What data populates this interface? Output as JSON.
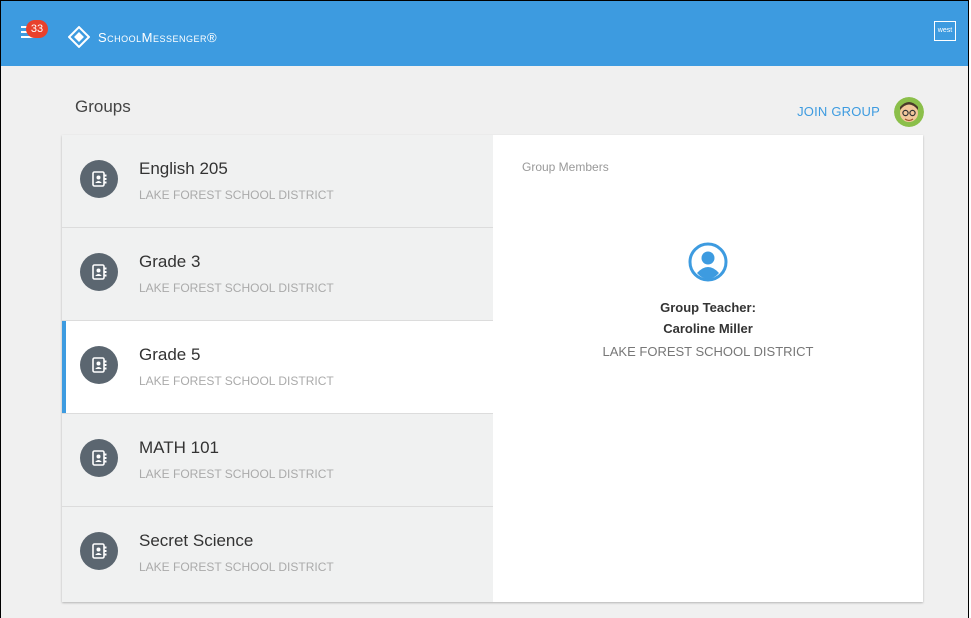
{
  "header": {
    "notification_count": "33",
    "brand": "SchoolMessenger®",
    "user_label": "west"
  },
  "page": {
    "title": "Groups",
    "join_label": "JOIN GROUP"
  },
  "groups": [
    {
      "name": "English 205",
      "district": "LAKE FOREST SCHOOL DISTRICT",
      "selected": false
    },
    {
      "name": "Grade 3",
      "district": "LAKE FOREST SCHOOL DISTRICT",
      "selected": false
    },
    {
      "name": "Grade 5",
      "district": "LAKE FOREST SCHOOL DISTRICT",
      "selected": true
    },
    {
      "name": "MATH 101",
      "district": "LAKE FOREST SCHOOL DISTRICT",
      "selected": false
    },
    {
      "name": "Secret Science",
      "district": "LAKE FOREST SCHOOL DISTRICT",
      "selected": false
    }
  ],
  "members": {
    "heading": "Group Members",
    "teacher_role": "Group Teacher:",
    "teacher_name": "Caroline Miller",
    "teacher_district": "LAKE FOREST SCHOOL DISTRICT"
  },
  "colors": {
    "accent": "#3d9be0",
    "badge": "#e8412c",
    "group_icon_bg": "#5b6670"
  }
}
